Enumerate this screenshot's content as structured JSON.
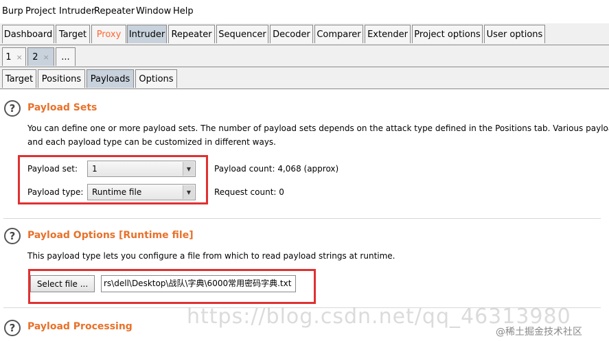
{
  "menu": [
    "Burp",
    "Project",
    "Intruder",
    "Repeater",
    "Window",
    "Help"
  ],
  "main_tabs": [
    "Dashboard",
    "Target",
    "Proxy",
    "Intruder",
    "Repeater",
    "Sequencer",
    "Decoder",
    "Comparer",
    "Extender",
    "Project options",
    "User options"
  ],
  "attack_tabs": [
    {
      "label": "1",
      "close": "×"
    },
    {
      "label": "2",
      "close": "×"
    },
    {
      "label": "..."
    }
  ],
  "sub_tabs": [
    "Target",
    "Positions",
    "Payloads",
    "Options"
  ],
  "payload_sets": {
    "title": "Payload Sets",
    "description_1": "You can define one or more payload sets. The number of payload sets depends on the attack type defined in the Positions tab. Various payload typ",
    "description_2": "and each payload type can be customized in different ways.",
    "set_label": "Payload set:",
    "set_value": "1",
    "type_label": "Payload type:",
    "type_value": "Runtime file",
    "payload_count_label": "Payload count:",
    "payload_count_value": "4,068 (approx)",
    "request_count_label": "Request count:",
    "request_count_value": "0"
  },
  "payload_options": {
    "title": "Payload Options [Runtime file]",
    "description": "This payload type lets you configure a file from which to read payload strings at runtime.",
    "select_button": "Select file ...",
    "file_path": "rs\\dell\\Desktop\\战队\\字典\\6000常用密码字典.txt"
  },
  "payload_processing": {
    "title": "Payload Processing"
  },
  "watermark": "https://blog.csdn.net/qq_46313980",
  "watermark_site": "@稀土掘金技术社区",
  "help_glyph": "?",
  "colors": {
    "accent_title": "#e8712a",
    "proxy_tab": "#ff6633",
    "highlight_box": "#e03030",
    "selected_tab": "#c8d2dc"
  }
}
